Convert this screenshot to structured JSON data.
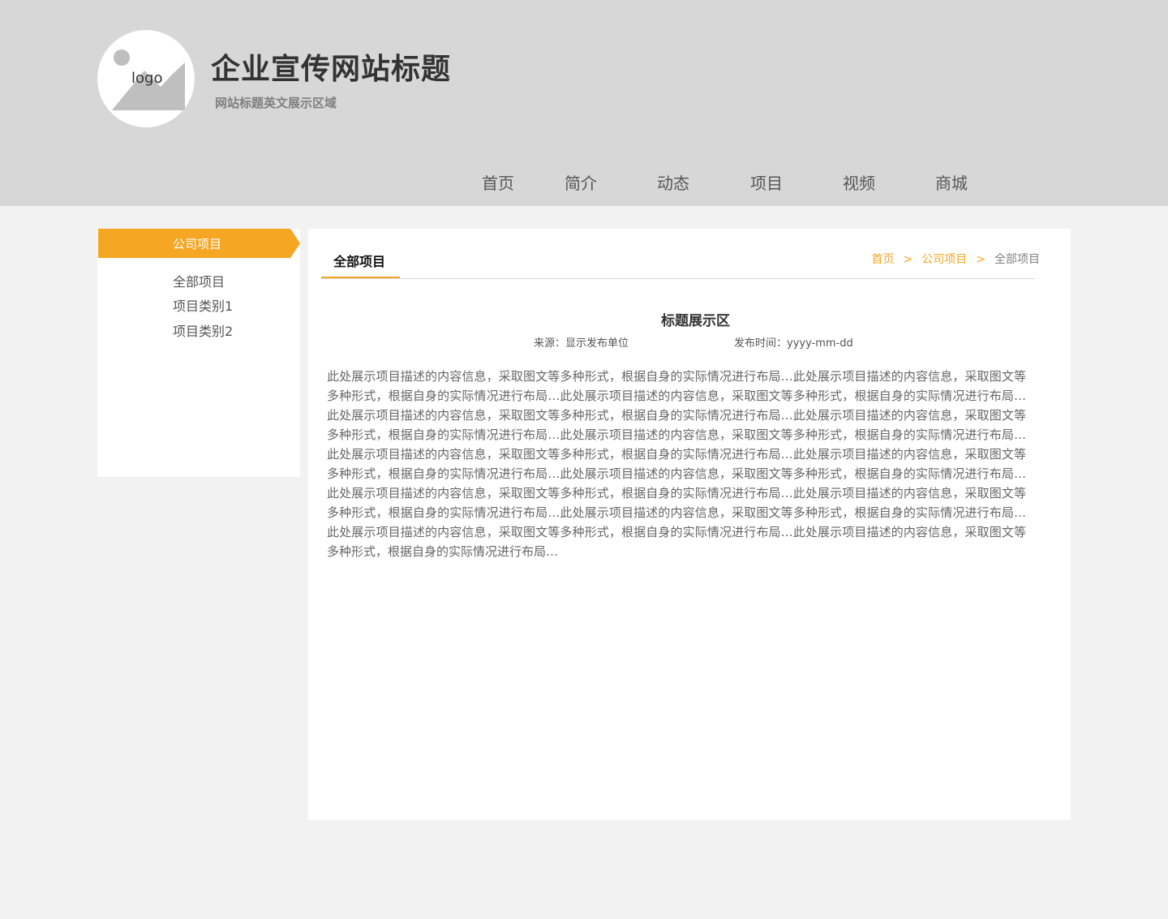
{
  "header": {
    "logo_text": "logo",
    "title": "企业宣传网站标题",
    "subtitle": "网站标题英文展示区域"
  },
  "nav": {
    "items": [
      {
        "label": "首页"
      },
      {
        "label": "简介"
      },
      {
        "label": "动态"
      },
      {
        "label": "项目"
      },
      {
        "label": "视频"
      },
      {
        "label": "商城"
      }
    ]
  },
  "sidebar": {
    "heading": "公司项目",
    "items": [
      {
        "label": "全部项目"
      },
      {
        "label": "项目类别1"
      },
      {
        "label": "项目类别2"
      }
    ]
  },
  "main": {
    "tab": "全部项目",
    "breadcrumb": {
      "home": "首页",
      "separator": ">",
      "section": "公司项目",
      "current": "全部项目"
    },
    "article": {
      "title": "标题展示区",
      "source": "来源：显示发布单位",
      "publish_time": "发布时间：yyyy-mm-dd",
      "body": "此处展示项目描述的内容信息，采取图文等多种形式，根据自身的实际情况进行布局…此处展示项目描述的内容信息，采取图文等多种形式，根据自身的实际情况进行布局…此处展示项目描述的内容信息，采取图文等多种形式，根据自身的实际情况进行布局…此处展示项目描述的内容信息，采取图文等多种形式，根据自身的实际情况进行布局…此处展示项目描述的内容信息，采取图文等多种形式，根据自身的实际情况进行布局…此处展示项目描述的内容信息，采取图文等多种形式，根据自身的实际情况进行布局…此处展示项目描述的内容信息，采取图文等多种形式，根据自身的实际情况进行布局…此处展示项目描述的内容信息，采取图文等多种形式，根据自身的实际情况进行布局…此处展示项目描述的内容信息，采取图文等多种形式，根据自身的实际情况进行布局…此处展示项目描述的内容信息，采取图文等多种形式，根据自身的实际情况进行布局…此处展示项目描述的内容信息，采取图文等多种形式，根据自身的实际情况进行布局…此处展示项目描述的内容信息，采取图文等多种形式，根据自身的实际情况进行布局…此处展示项目描述的内容信息，采取图文等多种形式，根据自身的实际情况进行布局…此处展示项目描述的内容信息，采取图文等多种形式，根据自身的实际情况进行布局…"
    }
  },
  "colors": {
    "accent": "#f5a623",
    "header_bg": "#d7d7d7",
    "page_bg": "#f2f2f2"
  }
}
